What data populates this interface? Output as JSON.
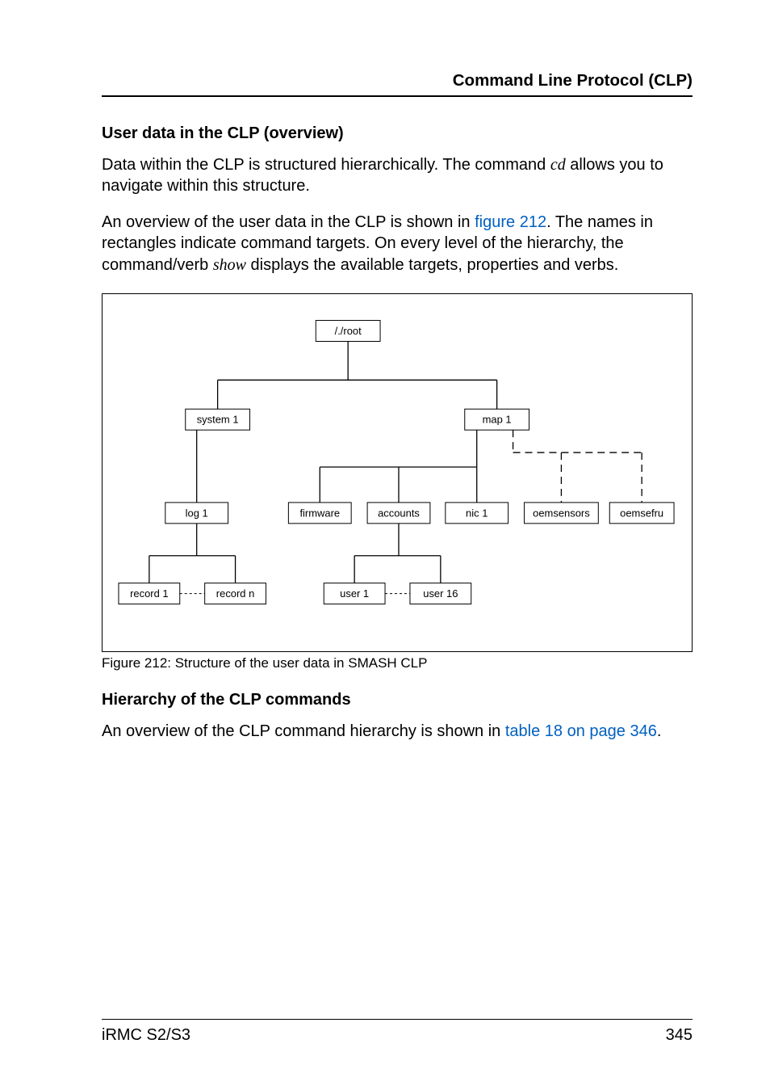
{
  "running_head": "Command Line Protocol (CLP)",
  "section1_title": "User data in the CLP (overview)",
  "para1_a": "Data within the CLP is structured hierarchically. The command ",
  "para1_cd": "cd",
  "para1_b": " allows you to navigate within this structure.",
  "para2_a": "An overview of the user data in the CLP is shown in ",
  "para2_link": "figure 212",
  "para2_b": ". The names in rectangles indicate command targets. On every level of the hierarchy, the command/verb ",
  "para2_show": "show",
  "para2_c": " displays the available targets, properties and verbs.",
  "fig_caption": "Figure 212: Structure of the user data in SMASH CLP",
  "section2_title": "Hierarchy of the CLP commands",
  "para3_a": "An overview of the CLP command hierarchy is shown in ",
  "para3_link": "table 18 on page 346",
  "para3_b": ".",
  "footer_left": "iRMC S2/S3",
  "footer_right": "345",
  "chart_data": {
    "type": "tree",
    "title": "Structure of the user data in SMASH CLP",
    "nodes": {
      "root": {
        "label": "/./root"
      },
      "system1": {
        "label": "system 1"
      },
      "map1": {
        "label": "map 1"
      },
      "log1": {
        "label": "log 1"
      },
      "firmware": {
        "label": "firmware"
      },
      "accounts": {
        "label": "accounts"
      },
      "nic1": {
        "label": "nic 1"
      },
      "oemsensors": {
        "label": "oemsensors"
      },
      "oemsefru": {
        "label": "oemsefru"
      },
      "record1": {
        "label": "record 1"
      },
      "recordn": {
        "label": "record n"
      },
      "user1": {
        "label": "user 1"
      },
      "user16": {
        "label": "user 16"
      }
    },
    "edges_solid": [
      [
        "root",
        "system1"
      ],
      [
        "root",
        "map1"
      ],
      [
        "system1",
        "log1"
      ],
      [
        "map1",
        "firmware"
      ],
      [
        "map1",
        "accounts"
      ],
      [
        "map1",
        "nic1"
      ],
      [
        "log1",
        "record1"
      ],
      [
        "log1",
        "recordn"
      ],
      [
        "accounts",
        "user1"
      ],
      [
        "accounts",
        "user16"
      ]
    ],
    "edges_dashed_long": [
      [
        "map1",
        "oemsensors"
      ],
      [
        "map1",
        "oemsefru"
      ]
    ],
    "ellipsis_dashed_between": [
      [
        "record1",
        "recordn"
      ],
      [
        "user1",
        "user16"
      ]
    ]
  }
}
